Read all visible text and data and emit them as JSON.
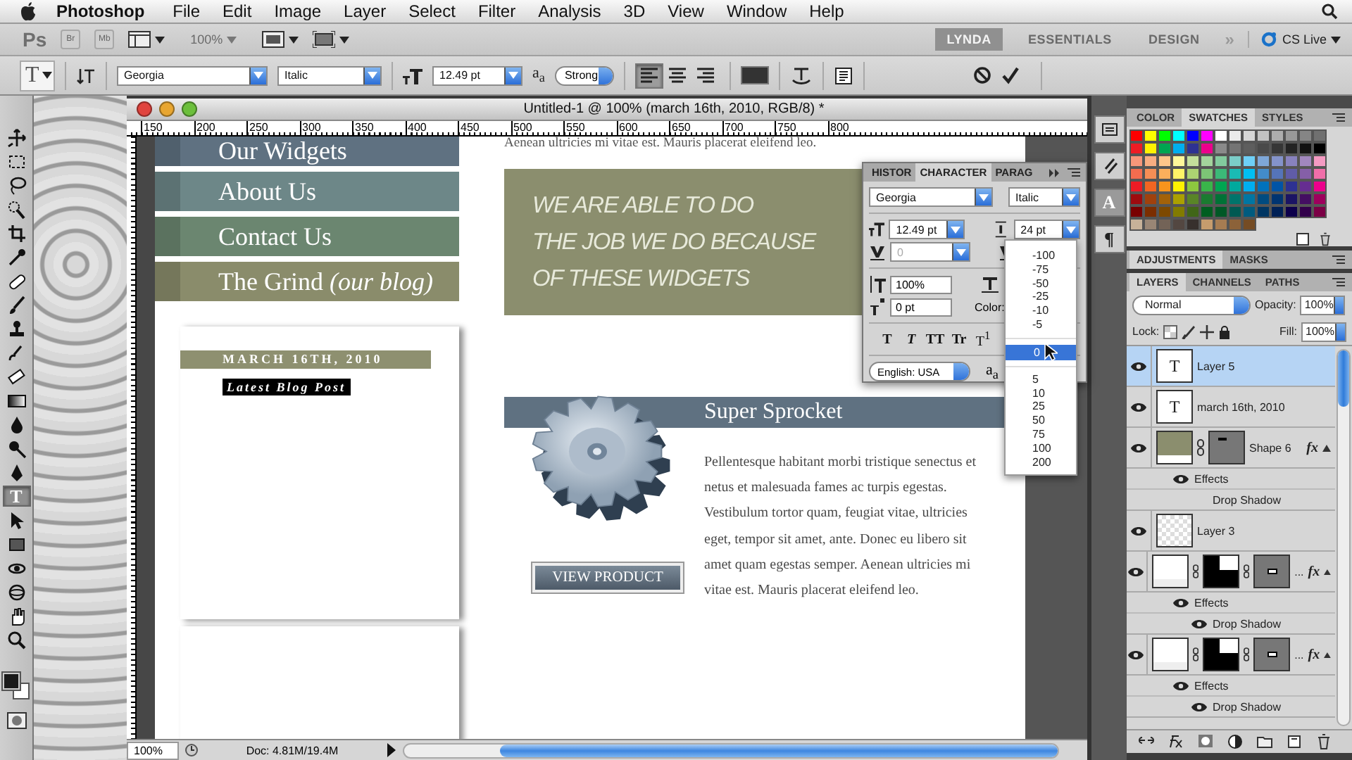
{
  "menu_bar": {
    "app_name": "Photoshop",
    "items": [
      "File",
      "Edit",
      "Image",
      "Layer",
      "Select",
      "Filter",
      "Analysis",
      "3D",
      "View",
      "Window",
      "Help"
    ]
  },
  "app_bar": {
    "badges": [
      "Ps",
      "Br",
      "Mb"
    ],
    "zoom": "100%",
    "workspaces": [
      {
        "label": "LYNDA",
        "selected": true
      },
      {
        "label": "ESSENTIALS",
        "selected": false
      },
      {
        "label": "DESIGN",
        "selected": false
      }
    ],
    "more": "»",
    "cs_live": "CS Live"
  },
  "options_bar": {
    "tool_glyph": "T",
    "font_family": "Georgia",
    "font_style": "Italic",
    "font_size": "12.49 pt",
    "antialias_mark": "a$_{a}$",
    "antialias": "Strong",
    "align": [
      {
        "kind": "left",
        "selected": true
      },
      {
        "kind": "center",
        "selected": false
      },
      {
        "kind": "right",
        "selected": false
      }
    ]
  },
  "tools": [
    {
      "kind": "move",
      "selected": false
    },
    {
      "kind": "marquee",
      "selected": false
    },
    {
      "kind": "lasso",
      "selected": false
    },
    {
      "kind": "quick-select",
      "selected": false
    },
    {
      "kind": "crop",
      "selected": false
    },
    {
      "kind": "eyedropper",
      "selected": false
    },
    {
      "kind": "healing",
      "selected": false
    },
    {
      "kind": "brush",
      "selected": false
    },
    {
      "kind": "stamp",
      "selected": false
    },
    {
      "kind": "history",
      "selected": false
    },
    {
      "kind": "eraser",
      "selected": false
    },
    {
      "kind": "gradient",
      "selected": false
    },
    {
      "kind": "blur",
      "selected": false
    },
    {
      "kind": "dodge",
      "selected": false
    },
    {
      "kind": "pen",
      "selected": false
    },
    {
      "kind": "type",
      "glyph": "T",
      "selected": true
    },
    {
      "kind": "path-select",
      "selected": false
    },
    {
      "kind": "rectangle",
      "selected": false
    },
    {
      "kind": "rotate-3d",
      "selected": false
    },
    {
      "kind": "orbit-3d",
      "selected": false
    },
    {
      "kind": "hand",
      "selected": false
    },
    {
      "kind": "zoom",
      "selected": false
    }
  ],
  "document": {
    "title": "Untitled-1 @ 100% (march 16th, 2010, RGB/8) *",
    "ruler": [
      "150",
      "200",
      "250",
      "300",
      "350",
      "400",
      "450",
      "500",
      "550",
      "600",
      "650",
      "700",
      "750",
      "800"
    ],
    "canvas": {
      "nav": [
        {
          "label": "Our Widgets",
          "color": "#5f7181"
        },
        {
          "label": "About Us",
          "color": "#6d8788"
        },
        {
          "label": "Contact Us",
          "color": "#6b8670"
        },
        {
          "label": "The Grind *(our blog)*",
          "color": "#8a8c6b"
        }
      ],
      "intro_text": "Aenean ultricies mi vitae est. Mauris placerat eleifend leo.",
      "tagline": [
        "WE ARE ABLE TO DO",
        "THE JOB WE DO BECAUSE",
        "OF THESE WIDGETS"
      ],
      "blog": {
        "date": "MARCH 16TH, 2010",
        "label": "Latest Blog Post"
      },
      "product": {
        "title": "Super Sprocket",
        "description": "Pellentesque habitant morbi tristique senectus et netus et malesuada fames ac turpis egestas. Vestibulum tortor quam, feugiat vitae, ultricies eget, tempor sit amet, ante. Donec eu libero sit amet quam egestas semper. Aenean ultricies mi vitae est. Mauris placerat eleifend leo.",
        "button": "VIEW PRODUCT"
      }
    },
    "status": {
      "zoom": "100%",
      "doc_info": "Doc: 4.81M/19.4M"
    }
  },
  "character_panel": {
    "tabs": [
      {
        "label": "HISTOR",
        "selected": false
      },
      {
        "label": "CHARACTER",
        "selected": true
      },
      {
        "label": "PARAG",
        "selected": false
      }
    ],
    "font_family": "Georgia",
    "font_style": "Italic",
    "size": "12.49 pt",
    "leading": "24 pt",
    "kerning": "0",
    "vertical_scale": "100%",
    "baseline_shift": "0 pt",
    "color_label": "Color:",
    "style_buttons": [
      {
        "label": "T",
        "kind": "bold"
      },
      {
        "label": "T",
        "kind": "italic"
      },
      {
        "label": "TT",
        "kind": "caps"
      },
      {
        "label": "Tr",
        "kind": "small-caps"
      },
      {
        "label": "T$^{1}$",
        "kind": "superscript"
      }
    ],
    "language": "English: USA",
    "antialias_mark": "a$_{a}$",
    "tracking_menu": [
      {
        "label": "-100",
        "selected": false
      },
      {
        "label": "-75",
        "selected": false
      },
      {
        "label": "-50",
        "selected": false
      },
      {
        "label": "-25",
        "selected": false
      },
      {
        "label": "-10",
        "selected": false
      },
      {
        "label": "-5",
        "selected": false
      },
      {
        "label": "0",
        "selected": true
      },
      {
        "label": "5",
        "selected": false
      },
      {
        "label": "10",
        "selected": false
      },
      {
        "label": "25",
        "selected": false
      },
      {
        "label": "50",
        "selected": false
      },
      {
        "label": "75",
        "selected": false
      },
      {
        "label": "100",
        "selected": false
      },
      {
        "label": "200",
        "selected": false
      }
    ]
  },
  "dock": [
    {
      "kind": "mini-bridge",
      "selected": false
    },
    {
      "kind": "brushes",
      "selected": false
    },
    {
      "kind": "character",
      "glyph": "A",
      "selected": true
    },
    {
      "kind": "paragraph",
      "glyph": "¶",
      "selected": false
    }
  ],
  "swatches_panel": {
    "tabs": [
      {
        "label": "COLOR",
        "selected": false
      },
      {
        "label": "SWATCHES",
        "selected": true
      },
      {
        "label": "STYLES",
        "selected": false
      }
    ],
    "rows": [
      [
        {
          "color": "#ff0000"
        },
        {
          "color": "#ffff00"
        },
        {
          "color": "#00ff00"
        },
        {
          "color": "#00ffff"
        },
        {
          "color": "#0000ff"
        },
        {
          "color": "#ff00ff"
        },
        {
          "color": "#ffffff"
        },
        {
          "color": "#ebebeb"
        },
        {
          "color": "#d6d6d6"
        },
        {
          "color": "#c2c2c2"
        },
        {
          "color": "#adadad"
        },
        {
          "color": "#999999"
        },
        {
          "color": "#858585"
        },
        {
          "color": "#707070"
        }
      ],
      [
        {
          "color": "#ed1c24"
        },
        {
          "color": "#fff200"
        },
        {
          "color": "#00a651"
        },
        {
          "color": "#00aeef"
        },
        {
          "color": "#2e3192"
        },
        {
          "color": "#ec008c"
        },
        {
          "color": "#8a8a8a"
        },
        {
          "color": "#747474"
        },
        {
          "color": "#5e5e5e"
        },
        {
          "color": "#4a4a4a"
        },
        {
          "color": "#363636"
        },
        {
          "color": "#242424"
        },
        {
          "color": "#121212"
        },
        {
          "color": "#000000"
        }
      ],
      [
        {
          "color": "#f7977a"
        },
        {
          "color": "#f9ad81"
        },
        {
          "color": "#fdc68a"
        },
        {
          "color": "#fff79a"
        },
        {
          "color": "#c4df9b"
        },
        {
          "color": "#a3d39c"
        },
        {
          "color": "#82ca9d"
        },
        {
          "color": "#7bcdc8"
        },
        {
          "color": "#6ecff6"
        },
        {
          "color": "#7ea7d8"
        },
        {
          "color": "#8493ca"
        },
        {
          "color": "#8882be"
        },
        {
          "color": "#a187be"
        },
        {
          "color": "#f49ac2"
        }
      ],
      [
        {
          "color": "#f26c4f"
        },
        {
          "color": "#f68e55"
        },
        {
          "color": "#fbaf5c"
        },
        {
          "color": "#fff467"
        },
        {
          "color": "#acd372"
        },
        {
          "color": "#7cc576"
        },
        {
          "color": "#3bb878"
        },
        {
          "color": "#1abbb4"
        },
        {
          "color": "#00bff3"
        },
        {
          "color": "#438cca"
        },
        {
          "color": "#5574b9"
        },
        {
          "color": "#605ca8"
        },
        {
          "color": "#855fa8"
        },
        {
          "color": "#f06ea9"
        }
      ],
      [
        {
          "color": "#ed1c24"
        },
        {
          "color": "#f26522"
        },
        {
          "color": "#f7941d"
        },
        {
          "color": "#fff200"
        },
        {
          "color": "#8dc73f"
        },
        {
          "color": "#39b54a"
        },
        {
          "color": "#00a651"
        },
        {
          "color": "#00a99d"
        },
        {
          "color": "#00aeef"
        },
        {
          "color": "#0072bc"
        },
        {
          "color": "#0054a6"
        },
        {
          "color": "#2e3192"
        },
        {
          "color": "#662d91"
        },
        {
          "color": "#ec008c"
        }
      ],
      [
        {
          "color": "#9e0b0f"
        },
        {
          "color": "#a0410d"
        },
        {
          "color": "#a36209"
        },
        {
          "color": "#aba000"
        },
        {
          "color": "#598527"
        },
        {
          "color": "#1a7b30"
        },
        {
          "color": "#007236"
        },
        {
          "color": "#00746b"
        },
        {
          "color": "#0076a3"
        },
        {
          "color": "#004b80"
        },
        {
          "color": "#003471"
        },
        {
          "color": "#1b1464"
        },
        {
          "color": "#440e62"
        },
        {
          "color": "#9e005d"
        }
      ],
      [
        {
          "color": "#790000"
        },
        {
          "color": "#7b2e00"
        },
        {
          "color": "#7d4900"
        },
        {
          "color": "#827b00"
        },
        {
          "color": "#406618"
        },
        {
          "color": "#005e20"
        },
        {
          "color": "#005826"
        },
        {
          "color": "#005952"
        },
        {
          "color": "#005b7f"
        },
        {
          "color": "#003663"
        },
        {
          "color": "#002157"
        },
        {
          "color": "#0d004c"
        },
        {
          "color": "#32004b"
        },
        {
          "color": "#7b0046"
        }
      ],
      [
        {
          "color": "#c7b299"
        },
        {
          "color": "#998675"
        },
        {
          "color": "#736357"
        },
        {
          "color": "#534741"
        },
        {
          "color": "#37302d"
        },
        {
          "color": "#c69c6d"
        },
        {
          "color": "#a67c52"
        },
        {
          "color": "#8c6239"
        },
        {
          "color": "#754c24"
        }
      ]
    ]
  },
  "adjustments_panel": {
    "tabs": [
      {
        "label": "ADJUSTMENTS",
        "selected": true
      },
      {
        "label": "MASKS",
        "selected": false
      }
    ]
  },
  "layers_panel": {
    "tabs": [
      {
        "label": "LAYERS",
        "selected": true
      },
      {
        "label": "CHANNELS",
        "selected": false
      },
      {
        "label": "PATHS",
        "selected": false
      }
    ],
    "blend_mode": "Normal",
    "opacity_label": "Opacity:",
    "opacity": "100%",
    "lock_label": "Lock:",
    "fill_label": "Fill:",
    "fill": "100%",
    "layers": [
      {
        "kind": "type",
        "glyph": "T",
        "name": "Layer 5",
        "selected": true,
        "visible": true
      },
      {
        "kind": "type",
        "glyph": "T",
        "name": "march 16th, 2010",
        "selected": false,
        "visible": true
      },
      {
        "kind": "shape",
        "name": "Shape 6",
        "selected": false,
        "visible": true,
        "fx": "fx",
        "effects": {
          "label": "Effects",
          "visible": true,
          "items": [
            {
              "name": "Drop Shadow",
              "visible": false
            }
          ]
        }
      },
      {
        "kind": "raster",
        "name": "Layer 3",
        "selected": false,
        "visible": true
      },
      {
        "kind": "masked",
        "name": "...",
        "selected": false,
        "visible": true,
        "fx": "fx",
        "effects": {
          "label": "Effects",
          "visible": true,
          "items": [
            {
              "name": "Drop Shadow",
              "visible": true
            }
          ]
        }
      },
      {
        "kind": "masked",
        "name": "...",
        "selected": false,
        "visible": true,
        "fx": "fx",
        "effects": {
          "label": "Effects",
          "visible": true,
          "items": [
            {
              "name": "Drop Shadow",
              "visible": true
            }
          ]
        }
      }
    ]
  }
}
